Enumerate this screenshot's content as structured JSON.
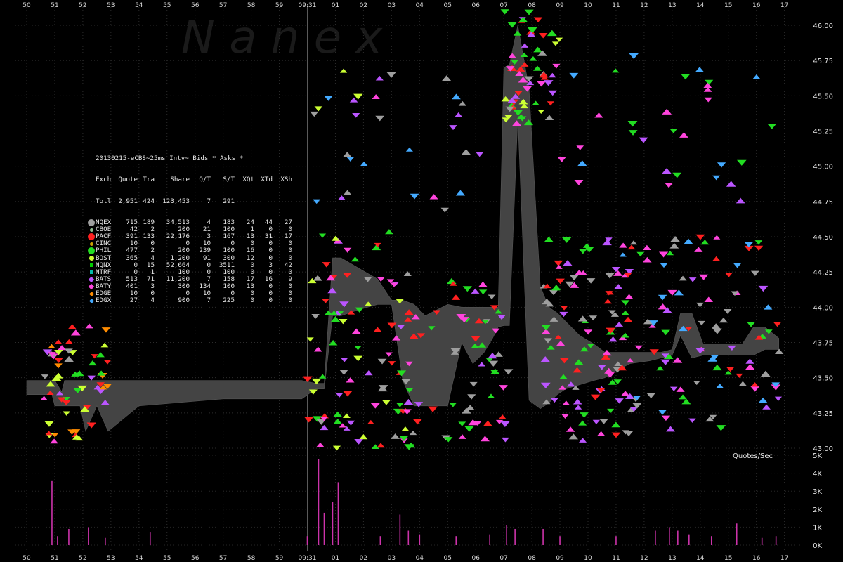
{
  "watermark": "N a n e x",
  "legend": {
    "title": "20130215-eCBS~25ms Intv~ Bids * Asks *",
    "columns": [
      "Exch",
      "Quote",
      "Tra",
      "Share",
      "Q/T",
      "S/T",
      "XQt",
      "XTd",
      "XSh"
    ],
    "total": {
      "label": "Totl",
      "values": [
        "2,951",
        "424",
        "123,453",
        "7",
        "291",
        "",
        "",
        ""
      ]
    },
    "rows": [
      {
        "exch": "NQEX",
        "color": "#9e9e9e",
        "shape": "circle-lg",
        "values": [
          "715",
          "189",
          "34,513",
          "4",
          "183",
          "24",
          "44",
          "27"
        ]
      },
      {
        "exch": "CBOE",
        "color": "#8fbc8f",
        "shape": "circle-sm",
        "values": [
          "42",
          "2",
          "200",
          "21",
          "100",
          "1",
          "0",
          "0"
        ]
      },
      {
        "exch": "PACF",
        "color": "#ff2020",
        "shape": "circle-lg",
        "values": [
          "391",
          "133",
          "22,176",
          "3",
          "167",
          "13",
          "31",
          "17"
        ]
      },
      {
        "exch": "CINC",
        "color": "#c8a000",
        "shape": "circle-sm",
        "values": [
          "10",
          "0",
          "0",
          "10",
          "0",
          "0",
          "0",
          "0"
        ]
      },
      {
        "exch": "PHIL",
        "color": "#22dd22",
        "shape": "circle-lg",
        "values": [
          "477",
          "2",
          "200",
          "239",
          "100",
          "16",
          "0",
          "0"
        ]
      },
      {
        "exch": "BOST",
        "color": "#ccff33",
        "shape": "circle-md",
        "values": [
          "365",
          "4",
          "1,200",
          "91",
          "300",
          "12",
          "0",
          "0"
        ]
      },
      {
        "exch": "NQNX",
        "color": "#00cc00",
        "shape": "square",
        "values": [
          "0",
          "15",
          "52,664",
          "0",
          "3511",
          "0",
          "3",
          "42"
        ]
      },
      {
        "exch": "NTRF",
        "color": "#00bbaa",
        "shape": "square",
        "values": [
          "0",
          "1",
          "100",
          "0",
          "100",
          "0",
          "0",
          "0"
        ]
      },
      {
        "exch": "BATS",
        "color": "#bb55ff",
        "shape": "diamond",
        "values": [
          "513",
          "71",
          "11,200",
          "7",
          "158",
          "17",
          "16",
          "9"
        ]
      },
      {
        "exch": "BATY",
        "color": "#ff44dd",
        "shape": "diamond",
        "values": [
          "401",
          "3",
          "300",
          "134",
          "100",
          "13",
          "0",
          "0"
        ]
      },
      {
        "exch": "EDGE",
        "color": "#ff8c00",
        "shape": "diamond-sm",
        "values": [
          "10",
          "0",
          "0",
          "10",
          "0",
          "0",
          "0",
          "0"
        ]
      },
      {
        "exch": "EDGX",
        "color": "#44aaff",
        "shape": "diamond-sm",
        "values": [
          "27",
          "4",
          "900",
          "7",
          "225",
          "0",
          "0",
          "0"
        ]
      }
    ]
  },
  "chart_data": {
    "type": "scatter",
    "x_ticks": [
      "50",
      "51",
      "52",
      "53",
      "54",
      "55",
      "56",
      "57",
      "58",
      "59",
      "09:31",
      "01",
      "02",
      "03",
      "04",
      "05",
      "06",
      "07",
      "08",
      "09",
      "10",
      "11",
      "12",
      "13",
      "14",
      "15",
      "16",
      "17"
    ],
    "y_ticks": [
      "43.00",
      "43.25",
      "43.50",
      "43.75",
      "44.00",
      "44.25",
      "44.50",
      "44.75",
      "45.00",
      "45.25",
      "45.50",
      "45.75",
      "46.00"
    ],
    "ylim": [
      43.0,
      46.0
    ],
    "grid": true,
    "nbbo_band": {
      "t": [
        0,
        0.9,
        1.0,
        1.25,
        1.35,
        1.9,
        2.1,
        2.5,
        2.9,
        4.0,
        7.0,
        9.8,
        10.3,
        10.6,
        10.9,
        11.2,
        11.8,
        12.5,
        13.0,
        13.4,
        13.8,
        14.2,
        15.0,
        15.5,
        15.9,
        16.3,
        16.6,
        16.8,
        17.0,
        17.2,
        17.5,
        17.9,
        18.3,
        18.6,
        18.9,
        19.2,
        19.7,
        20.2,
        20.6,
        21.0,
        21.5,
        22.2,
        22.6,
        23.0,
        23.3,
        23.7,
        24.1,
        24.5,
        25.0,
        25.5,
        25.9,
        26.3,
        26.8
      ],
      "bid": [
        43.38,
        43.38,
        43.3,
        43.3,
        43.3,
        43.3,
        43.12,
        43.3,
        43.12,
        43.3,
        43.35,
        43.35,
        43.42,
        43.42,
        43.94,
        43.94,
        43.98,
        44.02,
        44.02,
        43.48,
        43.3,
        43.3,
        43.3,
        43.75,
        43.6,
        43.68,
        43.78,
        43.86,
        43.87,
        43.87,
        45.35,
        43.34,
        43.28,
        43.32,
        43.38,
        43.42,
        43.45,
        43.48,
        43.5,
        43.55,
        43.6,
        43.62,
        43.64,
        43.66,
        43.8,
        43.64,
        43.66,
        43.66,
        43.66,
        43.66,
        43.66,
        43.7,
        43.7
      ],
      "ask": [
        43.48,
        43.48,
        43.48,
        43.4,
        43.48,
        43.48,
        43.48,
        43.48,
        43.48,
        43.48,
        43.48,
        43.48,
        43.46,
        43.46,
        44.35,
        44.35,
        44.28,
        44.2,
        44.05,
        44.05,
        44.02,
        43.94,
        44.02,
        44.0,
        44.0,
        44.0,
        44.0,
        44.0,
        45.7,
        45.72,
        46.0,
        45.55,
        44.15,
        44.0,
        43.96,
        43.9,
        43.8,
        43.74,
        43.68,
        43.68,
        43.68,
        43.68,
        43.68,
        43.7,
        43.96,
        43.96,
        43.74,
        43.74,
        43.74,
        43.74,
        43.86,
        43.86,
        43.78
      ]
    },
    "quotes_per_sec": {
      "label": "Quotes/Sec",
      "y_ticks": [
        "0K",
        "1K",
        "2K",
        "3K",
        "4K",
        "5K"
      ],
      "ylim": [
        0,
        5000
      ],
      "spikes": [
        {
          "t": 0.9,
          "v": 3600
        },
        {
          "t": 1.1,
          "v": 500
        },
        {
          "t": 1.5,
          "v": 900
        },
        {
          "t": 2.2,
          "v": 1000
        },
        {
          "t": 2.8,
          "v": 400
        },
        {
          "t": 4.4,
          "v": 700
        },
        {
          "t": 10.0,
          "v": 500
        },
        {
          "t": 10.4,
          "v": 4800
        },
        {
          "t": 10.6,
          "v": 1800
        },
        {
          "t": 10.9,
          "v": 2400
        },
        {
          "t": 11.1,
          "v": 3500
        },
        {
          "t": 12.6,
          "v": 500
        },
        {
          "t": 13.3,
          "v": 1700
        },
        {
          "t": 13.6,
          "v": 800
        },
        {
          "t": 14.0,
          "v": 600
        },
        {
          "t": 15.3,
          "v": 500
        },
        {
          "t": 16.5,
          "v": 600
        },
        {
          "t": 17.1,
          "v": 1100
        },
        {
          "t": 17.4,
          "v": 900
        },
        {
          "t": 18.4,
          "v": 900
        },
        {
          "t": 19.0,
          "v": 500
        },
        {
          "t": 21.0,
          "v": 500
        },
        {
          "t": 22.4,
          "v": 800
        },
        {
          "t": 22.9,
          "v": 1000
        },
        {
          "t": 23.2,
          "v": 800
        },
        {
          "t": 23.6,
          "v": 600
        },
        {
          "t": 24.4,
          "v": 500
        },
        {
          "t": 25.3,
          "v": 1200
        },
        {
          "t": 26.2,
          "v": 400
        },
        {
          "t": 26.7,
          "v": 500
        }
      ]
    },
    "quote_clusters": [
      {
        "t0": 0.6,
        "t1": 2.9,
        "p0": 43.05,
        "p1": 43.9,
        "n": 60,
        "colors": [
          "#22dd22",
          "#ff2020",
          "#ccff33",
          "#bb55ff",
          "#ff44dd",
          "#9e9e9e",
          "#ff8c00"
        ]
      },
      {
        "t0": 10.0,
        "t1": 13.7,
        "p0": 43.0,
        "p1": 44.55,
        "n": 90,
        "colors": [
          "#22dd22",
          "#ff2020",
          "#ccff33",
          "#bb55ff",
          "#ff44dd",
          "#9e9e9e"
        ]
      },
      {
        "t0": 13.0,
        "t1": 17.2,
        "p0": 43.05,
        "p1": 44.2,
        "n": 70,
        "colors": [
          "#22dd22",
          "#ff2020",
          "#bb55ff",
          "#ff44dd",
          "#9e9e9e"
        ]
      },
      {
        "t0": 17.0,
        "t1": 19.0,
        "p0": 45.3,
        "p1": 46.1,
        "n": 60,
        "colors": [
          "#22dd22",
          "#ff2020",
          "#bb55ff",
          "#ff44dd",
          "#9e9e9e",
          "#ccff33"
        ]
      },
      {
        "t0": 18.4,
        "t1": 21.5,
        "p0": 43.05,
        "p1": 44.5,
        "n": 100,
        "colors": [
          "#22dd22",
          "#ff2020",
          "#bb55ff",
          "#ff44dd",
          "#9e9e9e"
        ]
      },
      {
        "t0": 21.0,
        "t1": 26.9,
        "p0": 43.1,
        "p1": 44.5,
        "n": 110,
        "colors": [
          "#22dd22",
          "#ff2020",
          "#bb55ff",
          "#ff44dd",
          "#9e9e9e",
          "#44aaff"
        ]
      },
      {
        "t0": 10.0,
        "t1": 18.0,
        "p0": 44.6,
        "p1": 45.8,
        "n": 30,
        "colors": [
          "#ff44dd",
          "#bb55ff",
          "#ccff33",
          "#44aaff",
          "#9e9e9e"
        ]
      },
      {
        "t0": 19.0,
        "t1": 26.8,
        "p0": 44.7,
        "p1": 45.8,
        "n": 30,
        "colors": [
          "#ff44dd",
          "#bb55ff",
          "#22dd22",
          "#44aaff"
        ]
      }
    ]
  }
}
